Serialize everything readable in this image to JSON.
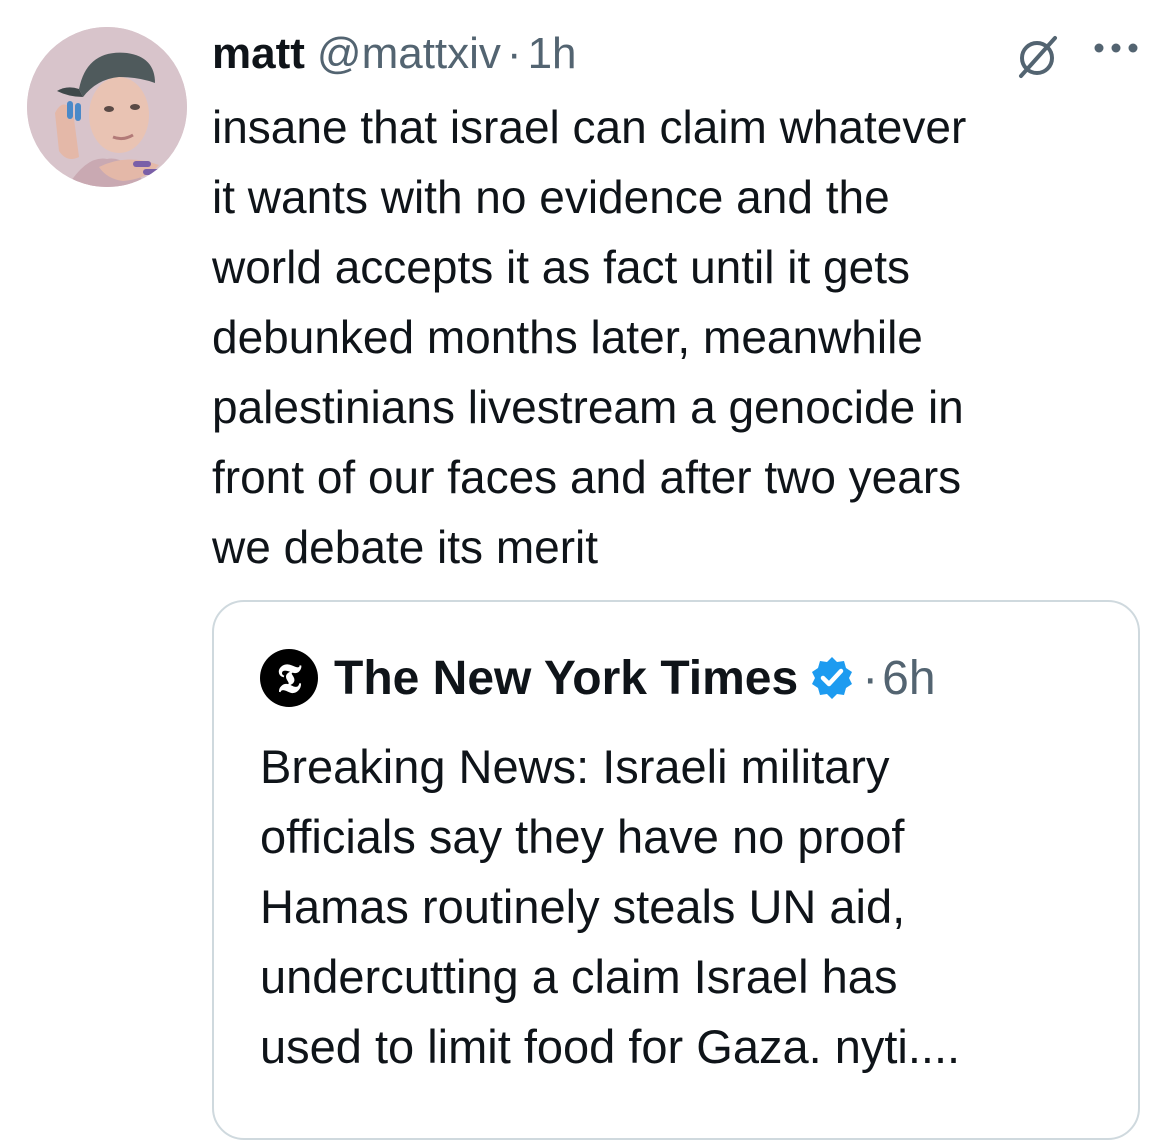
{
  "tweet": {
    "display_name": "matt",
    "handle": "@mattxiv",
    "separator": "·",
    "time": "1h",
    "icons": {
      "grok": "grok-icon",
      "more": "more-options-icon"
    },
    "text": "insane that israel can claim whatever\nit wants with no evidence and the\nworld accepts it as fact until it gets\ndebunked months later, meanwhile\npalestinians livestream a genocide in\nfront of our faces and after two years\nwe debate its merit"
  },
  "quoted_tweet": {
    "logo_glyph": "𝕿",
    "display_name": "The New York Times",
    "verified": true,
    "verified_color": "#1d9bf0",
    "separator": "·",
    "time": "6h",
    "text": "Breaking News: Israeli military\nofficials say they have no proof\nHamas routinely steals UN aid,\nundercutting a claim Israel has\nused to limit food for Gaza. nyti...."
  },
  "colors": {
    "text_primary": "#0f1419",
    "text_secondary": "#536471",
    "border": "#cfd9de"
  }
}
